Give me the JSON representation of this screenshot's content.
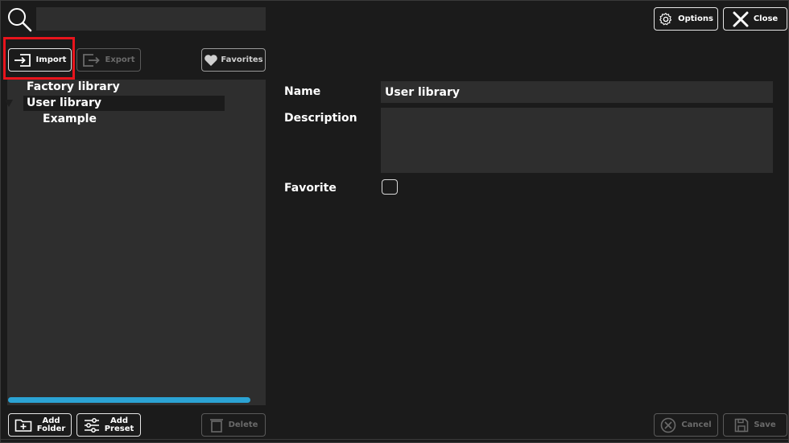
{
  "search": {
    "placeholder": "",
    "value": ""
  },
  "header": {
    "options_label": "Options",
    "close_label": "Close"
  },
  "toolbar": {
    "import_label": "Import",
    "export_label": "Export",
    "favorites_label": "Favorites"
  },
  "tree": {
    "items": [
      {
        "label": "Factory library"
      },
      {
        "label": "User library"
      },
      {
        "label": "Example"
      }
    ]
  },
  "details": {
    "name_label": "Name",
    "name_value": "User library",
    "description_label": "Description",
    "description_value": "",
    "favorite_label": "Favorite",
    "favorite_checked": false
  },
  "bottom": {
    "add_folder_label": "Add\nFolder",
    "add_preset_label": "Add\nPreset",
    "delete_label": "Delete",
    "cancel_label": "Cancel",
    "save_label": "Save"
  },
  "colors": {
    "background": "#1b1b1b",
    "panel": "#2e2e2e",
    "accent": "#2ba3d4",
    "highlight": "#e8141c"
  }
}
